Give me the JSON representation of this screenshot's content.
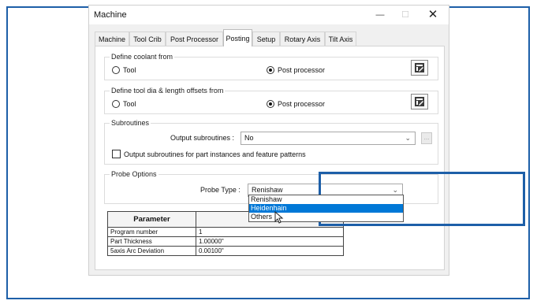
{
  "window": {
    "title": "Machine",
    "minimize": "—",
    "maximize": "☐",
    "close": "✕"
  },
  "tabs": [
    {
      "label": "Machine",
      "active": false
    },
    {
      "label": "Tool Crib",
      "active": false
    },
    {
      "label": "Post Processor",
      "active": false
    },
    {
      "label": "Posting",
      "active": true
    },
    {
      "label": "Setup",
      "active": false
    },
    {
      "label": "Rotary Axis",
      "active": false
    },
    {
      "label": "Tilt Axis",
      "active": false
    }
  ],
  "coolant": {
    "title": "Define coolant from",
    "option_tool": "Tool",
    "option_post": "Post processor",
    "selected": "Post processor"
  },
  "offsets": {
    "title": "Define tool dia & length offsets from",
    "option_tool": "Tool",
    "option_post": "Post processor",
    "selected": "Post processor"
  },
  "subroutines": {
    "title": "Subroutines",
    "output_label": "Output subroutines :",
    "output_value": "No",
    "ellipsis": "...",
    "checkbox_label": "Output subroutines for part instances and feature patterns",
    "checkbox_checked": false
  },
  "probe": {
    "title": "Probe Options",
    "type_label": "Probe Type :",
    "type_value": "Renishaw",
    "options": [
      "Renishaw",
      "Heidenhain",
      "Others"
    ],
    "highlighted": "Heidenhain"
  },
  "table": {
    "header": "Parameter",
    "rows": [
      {
        "name": "Program number",
        "value": "1"
      },
      {
        "name": "Part Thickness",
        "value": "1.00000\""
      },
      {
        "name": "5axis Arc Deviation",
        "value": "0.00100\""
      }
    ]
  },
  "colors": {
    "highlight_frame": "#1d5fa8",
    "selection": "#0078d7"
  }
}
